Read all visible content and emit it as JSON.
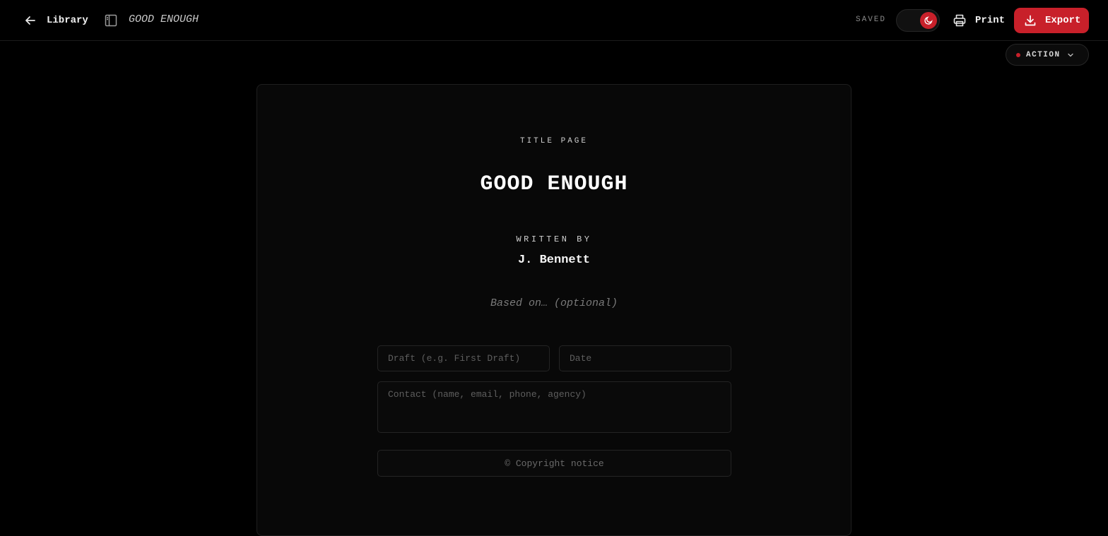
{
  "header": {
    "back_label": "Library",
    "doc_title": "GOOD ENOUGH",
    "saved_status": "SAVED",
    "print_label": "Print",
    "export_label": "Export"
  },
  "scene_type": {
    "label": "ACTION"
  },
  "title_page": {
    "section_label": "TITLE PAGE",
    "title": "GOOD ENOUGH",
    "written_by_label": "WRITTEN BY",
    "author": "J. Bennett",
    "based_on_placeholder": "Based on… (optional)",
    "draft_placeholder": "Draft (e.g. First Draft)",
    "date_placeholder": "Date",
    "contact_placeholder": "Contact (name, email, phone, agency)",
    "copyright_label": "© Copyright notice"
  },
  "colors": {
    "accent": "#c8202a",
    "background": "#000000",
    "page": "#080808"
  }
}
